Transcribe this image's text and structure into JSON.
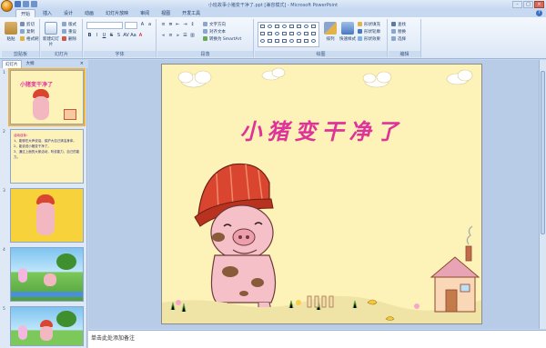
{
  "window": {
    "title": "小班故事小猪变干净了.ppt [兼容模式] - Microsoft PowerPoint",
    "minimize": "–",
    "maximize": "□",
    "close": "×"
  },
  "tabs": [
    "开始",
    "插入",
    "设计",
    "动画",
    "幻灯片放映",
    "审阅",
    "视图",
    "开发工具"
  ],
  "ribbon": {
    "clipboard": {
      "label": "剪贴板",
      "paste": "粘贴",
      "cut": "剪切",
      "copy": "复制",
      "format_painter": "格式刷"
    },
    "slides": {
      "label": "幻灯片",
      "new_slide": "新建幻灯片",
      "layout": "版式",
      "reset": "重设",
      "delete": "删除"
    },
    "font": {
      "label": "字体",
      "font_name": "",
      "font_size": ""
    },
    "paragraph": {
      "label": "段落",
      "text_direction": "文字方向",
      "align_text": "对齐文本",
      "smartart": "转换为 SmartArt"
    },
    "drawing": {
      "label": "绘图",
      "arrange": "排列",
      "quick_styles": "快速样式",
      "shape_fill": "形状填充",
      "shape_outline": "形状轮廓",
      "shape_effects": "形状效果"
    },
    "editing": {
      "label": "编辑",
      "find": "查找",
      "replace": "替换",
      "select": "选择"
    }
  },
  "panel": {
    "tabs": [
      "幻灯片",
      "大纲"
    ],
    "close": "×",
    "slide_numbers": [
      "1",
      "2",
      "3",
      "4",
      "5"
    ],
    "slide2_lines": [
      "活动目标：",
      "1、能够在大声说话、保护大自己清洁身体。",
      "2、能说说小猪变干净了。",
      "3、通过上面的大家活动，听说能力，自己的能力。"
    ]
  },
  "slide": {
    "title": "小猪变干净了"
  },
  "notes": {
    "placeholder": "单击此处添加备注"
  }
}
